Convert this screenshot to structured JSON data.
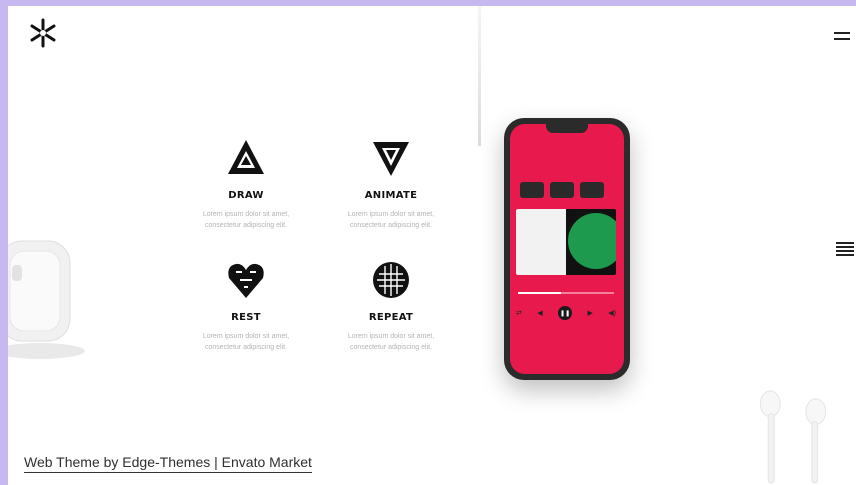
{
  "header": {
    "logo_icon": "snowflake-logo-icon",
    "menu_icon": "hamburger-menu-icon"
  },
  "side": {
    "menu_icon": "list-menu-icon"
  },
  "features": [
    {
      "title": "DRAW",
      "text_line1": "Lorem ipsum dolor sit amet,",
      "text_line2": "consectetur adipiscing elit.",
      "icon": "impossible-triangle-icon"
    },
    {
      "title": "ANIMATE",
      "text_line1": "Lorem ipsum dolor sit amet,",
      "text_line2": "consectetur adipiscing elit.",
      "icon": "inverted-triangle-knot-icon"
    },
    {
      "title": "REST",
      "text_line1": "Lorem ipsum dolor sit amet,",
      "text_line2": "consectetur adipiscing elit.",
      "icon": "heart-cubes-icon"
    },
    {
      "title": "REPEAT",
      "text_line1": "Lorem ipsum dolor sit amet,",
      "text_line2": "consectetur adipiscing elit.",
      "icon": "woven-knot-icon"
    }
  ],
  "phone": {
    "screen_color": "#e8194d",
    "playback_progress": 0.45,
    "controls": [
      "shuffle-icon",
      "previous-icon",
      "pause-icon",
      "next-icon",
      "volume-icon"
    ]
  },
  "footer": {
    "credit": "Web Theme by Edge-Themes | Envato Market"
  }
}
